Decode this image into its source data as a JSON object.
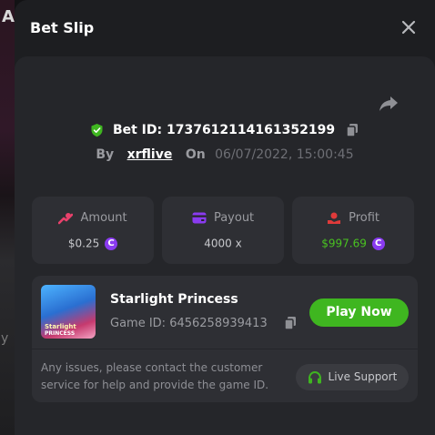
{
  "background": {
    "label": "A",
    "fragment": "y"
  },
  "modal": {
    "title": "Bet Slip",
    "bet": {
      "id_text": "Bet ID: 1737612114161352199",
      "by_label": "By",
      "username": "xrflive",
      "on_label": "On",
      "datetime": "06/07/2022, 15:00:45"
    },
    "stats": {
      "amount": {
        "label": "Amount",
        "value": "$0.25"
      },
      "payout": {
        "label": "Payout",
        "value": "4000 x"
      },
      "profit": {
        "label": "Profit",
        "value": "$997.69"
      }
    },
    "game": {
      "thumb_line1": "Starlight",
      "thumb_line2": "PRINCESS",
      "name": "Starlight Princess",
      "id_text": "Game ID: 6456258939413",
      "play_label": "Play Now"
    },
    "help_text": "Any issues, please contact the customer service for help and provide the game ID.",
    "support_label": "Live Support",
    "coin_symbol": "C"
  },
  "colors": {
    "accent_green": "#3fb620",
    "profit_green": "#49c221",
    "coin_purple": "#8a3bf0",
    "amount_icon_pink": "#e8416b",
    "payout_icon_purple": "#8a3bf0",
    "profit_icon_red": "#e03a3a",
    "shield_green": "#3fb620"
  }
}
